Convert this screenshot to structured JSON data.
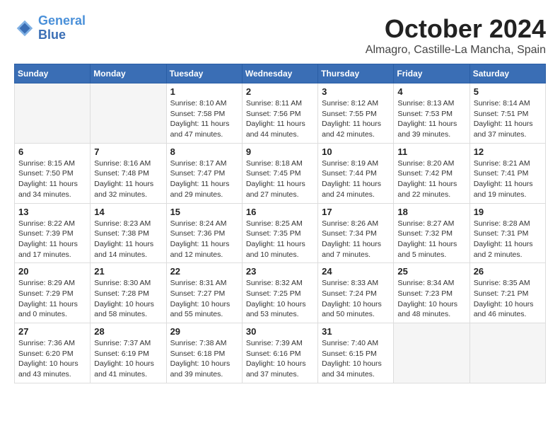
{
  "header": {
    "logo_line1": "General",
    "logo_line2": "Blue",
    "month": "October 2024",
    "location": "Almagro, Castille-La Mancha, Spain"
  },
  "weekdays": [
    "Sunday",
    "Monday",
    "Tuesday",
    "Wednesday",
    "Thursday",
    "Friday",
    "Saturday"
  ],
  "weeks": [
    [
      {
        "day": "",
        "info": ""
      },
      {
        "day": "",
        "info": ""
      },
      {
        "day": "1",
        "info": "Sunrise: 8:10 AM\nSunset: 7:58 PM\nDaylight: 11 hours and 47 minutes."
      },
      {
        "day": "2",
        "info": "Sunrise: 8:11 AM\nSunset: 7:56 PM\nDaylight: 11 hours and 44 minutes."
      },
      {
        "day": "3",
        "info": "Sunrise: 8:12 AM\nSunset: 7:55 PM\nDaylight: 11 hours and 42 minutes."
      },
      {
        "day": "4",
        "info": "Sunrise: 8:13 AM\nSunset: 7:53 PM\nDaylight: 11 hours and 39 minutes."
      },
      {
        "day": "5",
        "info": "Sunrise: 8:14 AM\nSunset: 7:51 PM\nDaylight: 11 hours and 37 minutes."
      }
    ],
    [
      {
        "day": "6",
        "info": "Sunrise: 8:15 AM\nSunset: 7:50 PM\nDaylight: 11 hours and 34 minutes."
      },
      {
        "day": "7",
        "info": "Sunrise: 8:16 AM\nSunset: 7:48 PM\nDaylight: 11 hours and 32 minutes."
      },
      {
        "day": "8",
        "info": "Sunrise: 8:17 AM\nSunset: 7:47 PM\nDaylight: 11 hours and 29 minutes."
      },
      {
        "day": "9",
        "info": "Sunrise: 8:18 AM\nSunset: 7:45 PM\nDaylight: 11 hours and 27 minutes."
      },
      {
        "day": "10",
        "info": "Sunrise: 8:19 AM\nSunset: 7:44 PM\nDaylight: 11 hours and 24 minutes."
      },
      {
        "day": "11",
        "info": "Sunrise: 8:20 AM\nSunset: 7:42 PM\nDaylight: 11 hours and 22 minutes."
      },
      {
        "day": "12",
        "info": "Sunrise: 8:21 AM\nSunset: 7:41 PM\nDaylight: 11 hours and 19 minutes."
      }
    ],
    [
      {
        "day": "13",
        "info": "Sunrise: 8:22 AM\nSunset: 7:39 PM\nDaylight: 11 hours and 17 minutes."
      },
      {
        "day": "14",
        "info": "Sunrise: 8:23 AM\nSunset: 7:38 PM\nDaylight: 11 hours and 14 minutes."
      },
      {
        "day": "15",
        "info": "Sunrise: 8:24 AM\nSunset: 7:36 PM\nDaylight: 11 hours and 12 minutes."
      },
      {
        "day": "16",
        "info": "Sunrise: 8:25 AM\nSunset: 7:35 PM\nDaylight: 11 hours and 10 minutes."
      },
      {
        "day": "17",
        "info": "Sunrise: 8:26 AM\nSunset: 7:34 PM\nDaylight: 11 hours and 7 minutes."
      },
      {
        "day": "18",
        "info": "Sunrise: 8:27 AM\nSunset: 7:32 PM\nDaylight: 11 hours and 5 minutes."
      },
      {
        "day": "19",
        "info": "Sunrise: 8:28 AM\nSunset: 7:31 PM\nDaylight: 11 hours and 2 minutes."
      }
    ],
    [
      {
        "day": "20",
        "info": "Sunrise: 8:29 AM\nSunset: 7:29 PM\nDaylight: 11 hours and 0 minutes."
      },
      {
        "day": "21",
        "info": "Sunrise: 8:30 AM\nSunset: 7:28 PM\nDaylight: 10 hours and 58 minutes."
      },
      {
        "day": "22",
        "info": "Sunrise: 8:31 AM\nSunset: 7:27 PM\nDaylight: 10 hours and 55 minutes."
      },
      {
        "day": "23",
        "info": "Sunrise: 8:32 AM\nSunset: 7:25 PM\nDaylight: 10 hours and 53 minutes."
      },
      {
        "day": "24",
        "info": "Sunrise: 8:33 AM\nSunset: 7:24 PM\nDaylight: 10 hours and 50 minutes."
      },
      {
        "day": "25",
        "info": "Sunrise: 8:34 AM\nSunset: 7:23 PM\nDaylight: 10 hours and 48 minutes."
      },
      {
        "day": "26",
        "info": "Sunrise: 8:35 AM\nSunset: 7:21 PM\nDaylight: 10 hours and 46 minutes."
      }
    ],
    [
      {
        "day": "27",
        "info": "Sunrise: 7:36 AM\nSunset: 6:20 PM\nDaylight: 10 hours and 43 minutes."
      },
      {
        "day": "28",
        "info": "Sunrise: 7:37 AM\nSunset: 6:19 PM\nDaylight: 10 hours and 41 minutes."
      },
      {
        "day": "29",
        "info": "Sunrise: 7:38 AM\nSunset: 6:18 PM\nDaylight: 10 hours and 39 minutes."
      },
      {
        "day": "30",
        "info": "Sunrise: 7:39 AM\nSunset: 6:16 PM\nDaylight: 10 hours and 37 minutes."
      },
      {
        "day": "31",
        "info": "Sunrise: 7:40 AM\nSunset: 6:15 PM\nDaylight: 10 hours and 34 minutes."
      },
      {
        "day": "",
        "info": ""
      },
      {
        "day": "",
        "info": ""
      }
    ]
  ]
}
